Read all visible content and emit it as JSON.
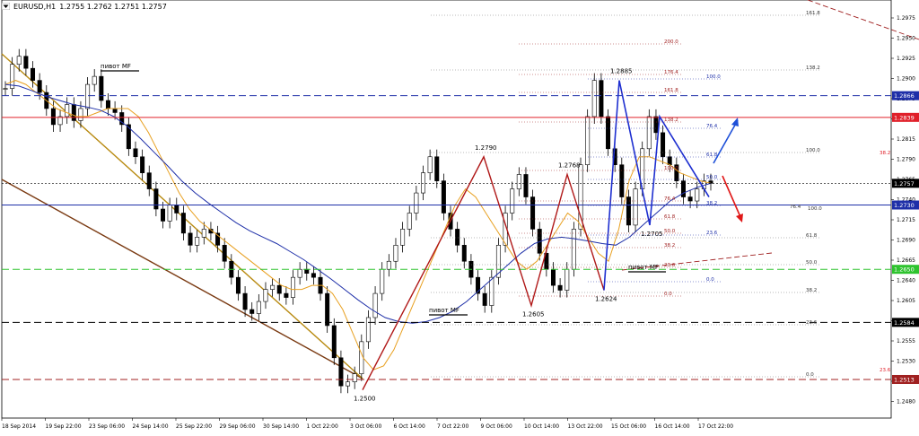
{
  "window": {
    "symbol": "EURUSD,H1",
    "ohlc": "1.2755 1.2762 1.2751 1.2757",
    "menu_icon": "chart-menu-arrow-icon"
  },
  "colors": {
    "background": "#ffffff",
    "candle": "#000000",
    "ma_fast": "#e8a020",
    "ma_slow": "#1e2fa8",
    "level_blue": "#1e2fa8",
    "level_red": "#e0202a",
    "level_green": "#2ec32e",
    "level_dark": "#000000",
    "level_darkred": "#a02020",
    "trend_brown": "#7a3a12",
    "trend_gold": "#b88a10",
    "wave_red": "#b01818",
    "wave_blue": "#1e2fd0",
    "arrow_blue": "#1e50d8",
    "arrow_red": "#e01818",
    "grid": "#d6d6d6"
  },
  "chart_data": {
    "type": "candlestick",
    "title": "EURUSD,H1",
    "ylim": [
      1.2465,
      1.2985
    ],
    "y_ticks": [
      "1.2975",
      "1.2950",
      "1.2925",
      "1.2900",
      "1.2875",
      "1.2850",
      "1.2815",
      "1.2790",
      "1.2765",
      "1.2740",
      "1.2715",
      "1.2690",
      "1.2665",
      "1.2640",
      "1.2605",
      "1.2580",
      "1.2555",
      "1.2530",
      "1.2505",
      "1.2480"
    ],
    "x_ticks": [
      "18 Sep 2014",
      "19 Sep 22:00",
      "23 Sep 06:00",
      "24 Sep 14:00",
      "25 Sep 22:00",
      "29 Sep 06:00",
      "30 Sep 14:00",
      "1 Oct 22:00",
      "3 Oct 06:00",
      "6 Oct 14:00",
      "7 Oct 22:00",
      "9 Oct 06:00",
      "10 Oct 14:00",
      "13 Oct 22:00",
      "15 Oct 06:00",
      "16 Oct 14:00",
      "17 Oct 22:00"
    ],
    "price_series": [
      1.2875,
      1.2905,
      1.2915,
      1.29,
      1.2885,
      1.287,
      1.285,
      1.283,
      1.284,
      1.2855,
      1.2835,
      1.285,
      1.288,
      1.289,
      1.286,
      1.285,
      1.2845,
      1.283,
      1.28,
      1.279,
      1.277,
      1.275,
      1.2725,
      1.271,
      1.273,
      1.272,
      1.2695,
      1.268,
      1.269,
      1.27,
      1.2695,
      1.268,
      1.266,
      1.264,
      1.262,
      1.26,
      1.2595,
      1.261,
      1.2625,
      1.263,
      1.262,
      1.2615,
      1.264,
      1.265,
      1.2645,
      1.264,
      1.262,
      1.258,
      1.254,
      1.2505,
      1.251,
      1.252,
      1.256,
      1.259,
      1.262,
      1.265,
      1.266,
      1.268,
      1.27,
      1.272,
      1.2745,
      1.277,
      1.279,
      1.276,
      1.272,
      1.27,
      1.268,
      1.266,
      1.264,
      1.262,
      1.2605,
      1.264,
      1.268,
      1.272,
      1.275,
      1.2768,
      1.274,
      1.27,
      1.267,
      1.265,
      1.263,
      1.2624,
      1.265,
      1.27,
      1.278,
      1.284,
      1.2885,
      1.284,
      1.28,
      1.278,
      1.274,
      1.2705,
      1.275,
      1.28,
      1.284,
      1.282,
      1.279,
      1.278,
      1.276,
      1.274,
      1.2735,
      1.275,
      1.276,
      1.2757
    ],
    "ma_fast": [
      1.288,
      1.2885,
      1.288,
      1.287,
      1.286,
      1.285,
      1.2845,
      1.284,
      1.284,
      1.2845,
      1.285,
      1.285,
      1.285,
      1.284,
      1.282,
      1.2795,
      1.277,
      1.2745,
      1.2725,
      1.271,
      1.27,
      1.269,
      1.268,
      1.267,
      1.266,
      1.265,
      1.264,
      1.263,
      1.2625,
      1.2625,
      1.263,
      1.263,
      1.262,
      1.26,
      1.257,
      1.254,
      1.2525,
      1.253,
      1.255,
      1.258,
      1.261,
      1.264,
      1.267,
      1.27,
      1.273,
      1.275,
      1.274,
      1.272,
      1.27,
      1.268,
      1.266,
      1.265,
      1.266,
      1.268,
      1.27,
      1.272,
      1.271,
      1.269,
      1.267,
      1.266,
      1.27,
      1.276,
      1.279,
      1.279,
      1.2785,
      1.278,
      1.277,
      1.2765,
      1.276,
      1.2757
    ],
    "ma_slow": [
      1.288,
      1.2878,
      1.2872,
      1.2865,
      1.286,
      1.2855,
      1.2852,
      1.2848,
      1.284,
      1.2828,
      1.2812,
      1.2795,
      1.2778,
      1.276,
      1.2745,
      1.2732,
      1.272,
      1.2708,
      1.2698,
      1.269,
      1.2682,
      1.2672,
      1.2662,
      1.265,
      1.2638,
      1.2625,
      1.2612,
      1.26,
      1.259,
      1.2585,
      1.2583,
      1.2585,
      1.259,
      1.2598,
      1.261,
      1.2625,
      1.264,
      1.2655,
      1.267,
      1.2682,
      1.2688,
      1.269,
      1.2688,
      1.2685,
      1.2682,
      1.268,
      1.269,
      1.2705,
      1.272,
      1.2735,
      1.2745,
      1.2752,
      1.2757
    ],
    "levels": [
      {
        "value": 1.2866,
        "label": "1.2866",
        "style": "dashed",
        "color": "#1e2fa8"
      },
      {
        "value": 1.2839,
        "label": "1.2839",
        "style": "solid",
        "color": "#e0202a"
      },
      {
        "value": 1.2757,
        "label": "1.2757",
        "style": "current",
        "color": "#000000"
      },
      {
        "value": 1.273,
        "label": "1.2730",
        "style": "solid",
        "color": "#1e2fa8"
      },
      {
        "value": 1.265,
        "label": "1.2650",
        "style": "dashed",
        "color": "#2ec32e"
      },
      {
        "value": 1.2584,
        "label": "1.2584",
        "style": "dashed",
        "color": "#000000"
      },
      {
        "value": 1.2513,
        "label": "1.2513",
        "style": "dashed",
        "color": "#a02020"
      }
    ],
    "wave_points": [
      {
        "label": "1.2500",
        "value": 1.25
      },
      {
        "label": "1.2790",
        "value": 1.279
      },
      {
        "label": "1.2605",
        "value": 1.2605
      },
      {
        "label": "1.2768",
        "value": 1.2768
      },
      {
        "label": "1.2624",
        "value": 1.2624
      },
      {
        "label": "1.2885",
        "value": 1.2885
      },
      {
        "label": "1.2705",
        "value": 1.2705
      }
    ],
    "annotations": [
      {
        "text": "пивот MF"
      },
      {
        "text": "пивот MF"
      },
      {
        "text": "пивот MF"
      }
    ],
    "fib_right": [
      "161.8",
      "138.2",
      "100.0",
      "61.8",
      "50.0",
      "38.2",
      "23.6",
      "0.0"
    ],
    "fib_blue": [
      "100.0",
      "76.4",
      "61.8",
      "50.0",
      "38.2",
      "23.6",
      "0.0"
    ],
    "fib_red": [
      "200.0",
      "176.4",
      "161.8",
      "138.2",
      "100.0",
      "76.4",
      "61.8",
      "50.0",
      "38.2",
      "23.6",
      "0.0"
    ],
    "side_labels": [
      "38.2",
      "23.6",
      "100.0",
      "76.4"
    ]
  }
}
